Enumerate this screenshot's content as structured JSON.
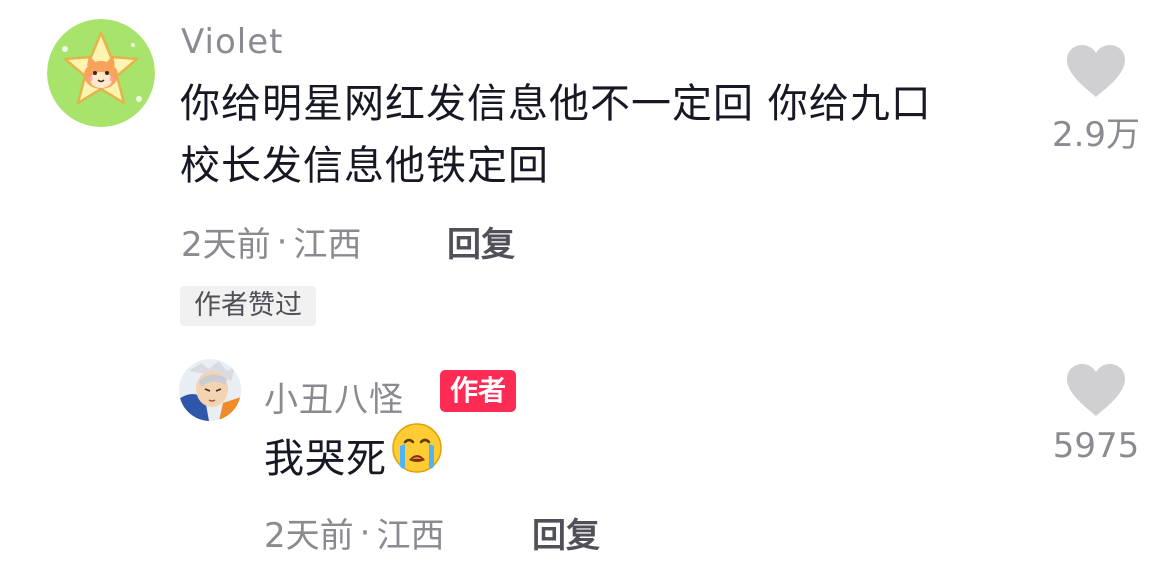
{
  "comment": {
    "username": "Violet",
    "text_line1": "你给明星网红发信息他不一定回 你给九口",
    "text_line2": "校长发信息他铁定回",
    "time": "2天前",
    "separator": "·",
    "location": "江西",
    "reply_label": "回复",
    "author_liked_badge": "作者赞过",
    "like_count": "2.9万",
    "avatar_icon": "star-cat-avatar-icon",
    "avatar_bg": "#a8e36b"
  },
  "reply": {
    "username": "小丑八怪",
    "author_tag": "作者",
    "text": "我哭死",
    "emoji": "crying-face-icon",
    "time": "2天前",
    "separator": "·",
    "location": "江西",
    "reply_label": "回复",
    "like_count": "5975",
    "avatar_icon": "anime-character-avatar-icon"
  },
  "colors": {
    "text_primary": "#161823",
    "text_secondary": "#8a8b91",
    "author_tag": "#fe2c55",
    "heart": "#d0d0d2",
    "badge_bg": "#f1f1f2"
  }
}
